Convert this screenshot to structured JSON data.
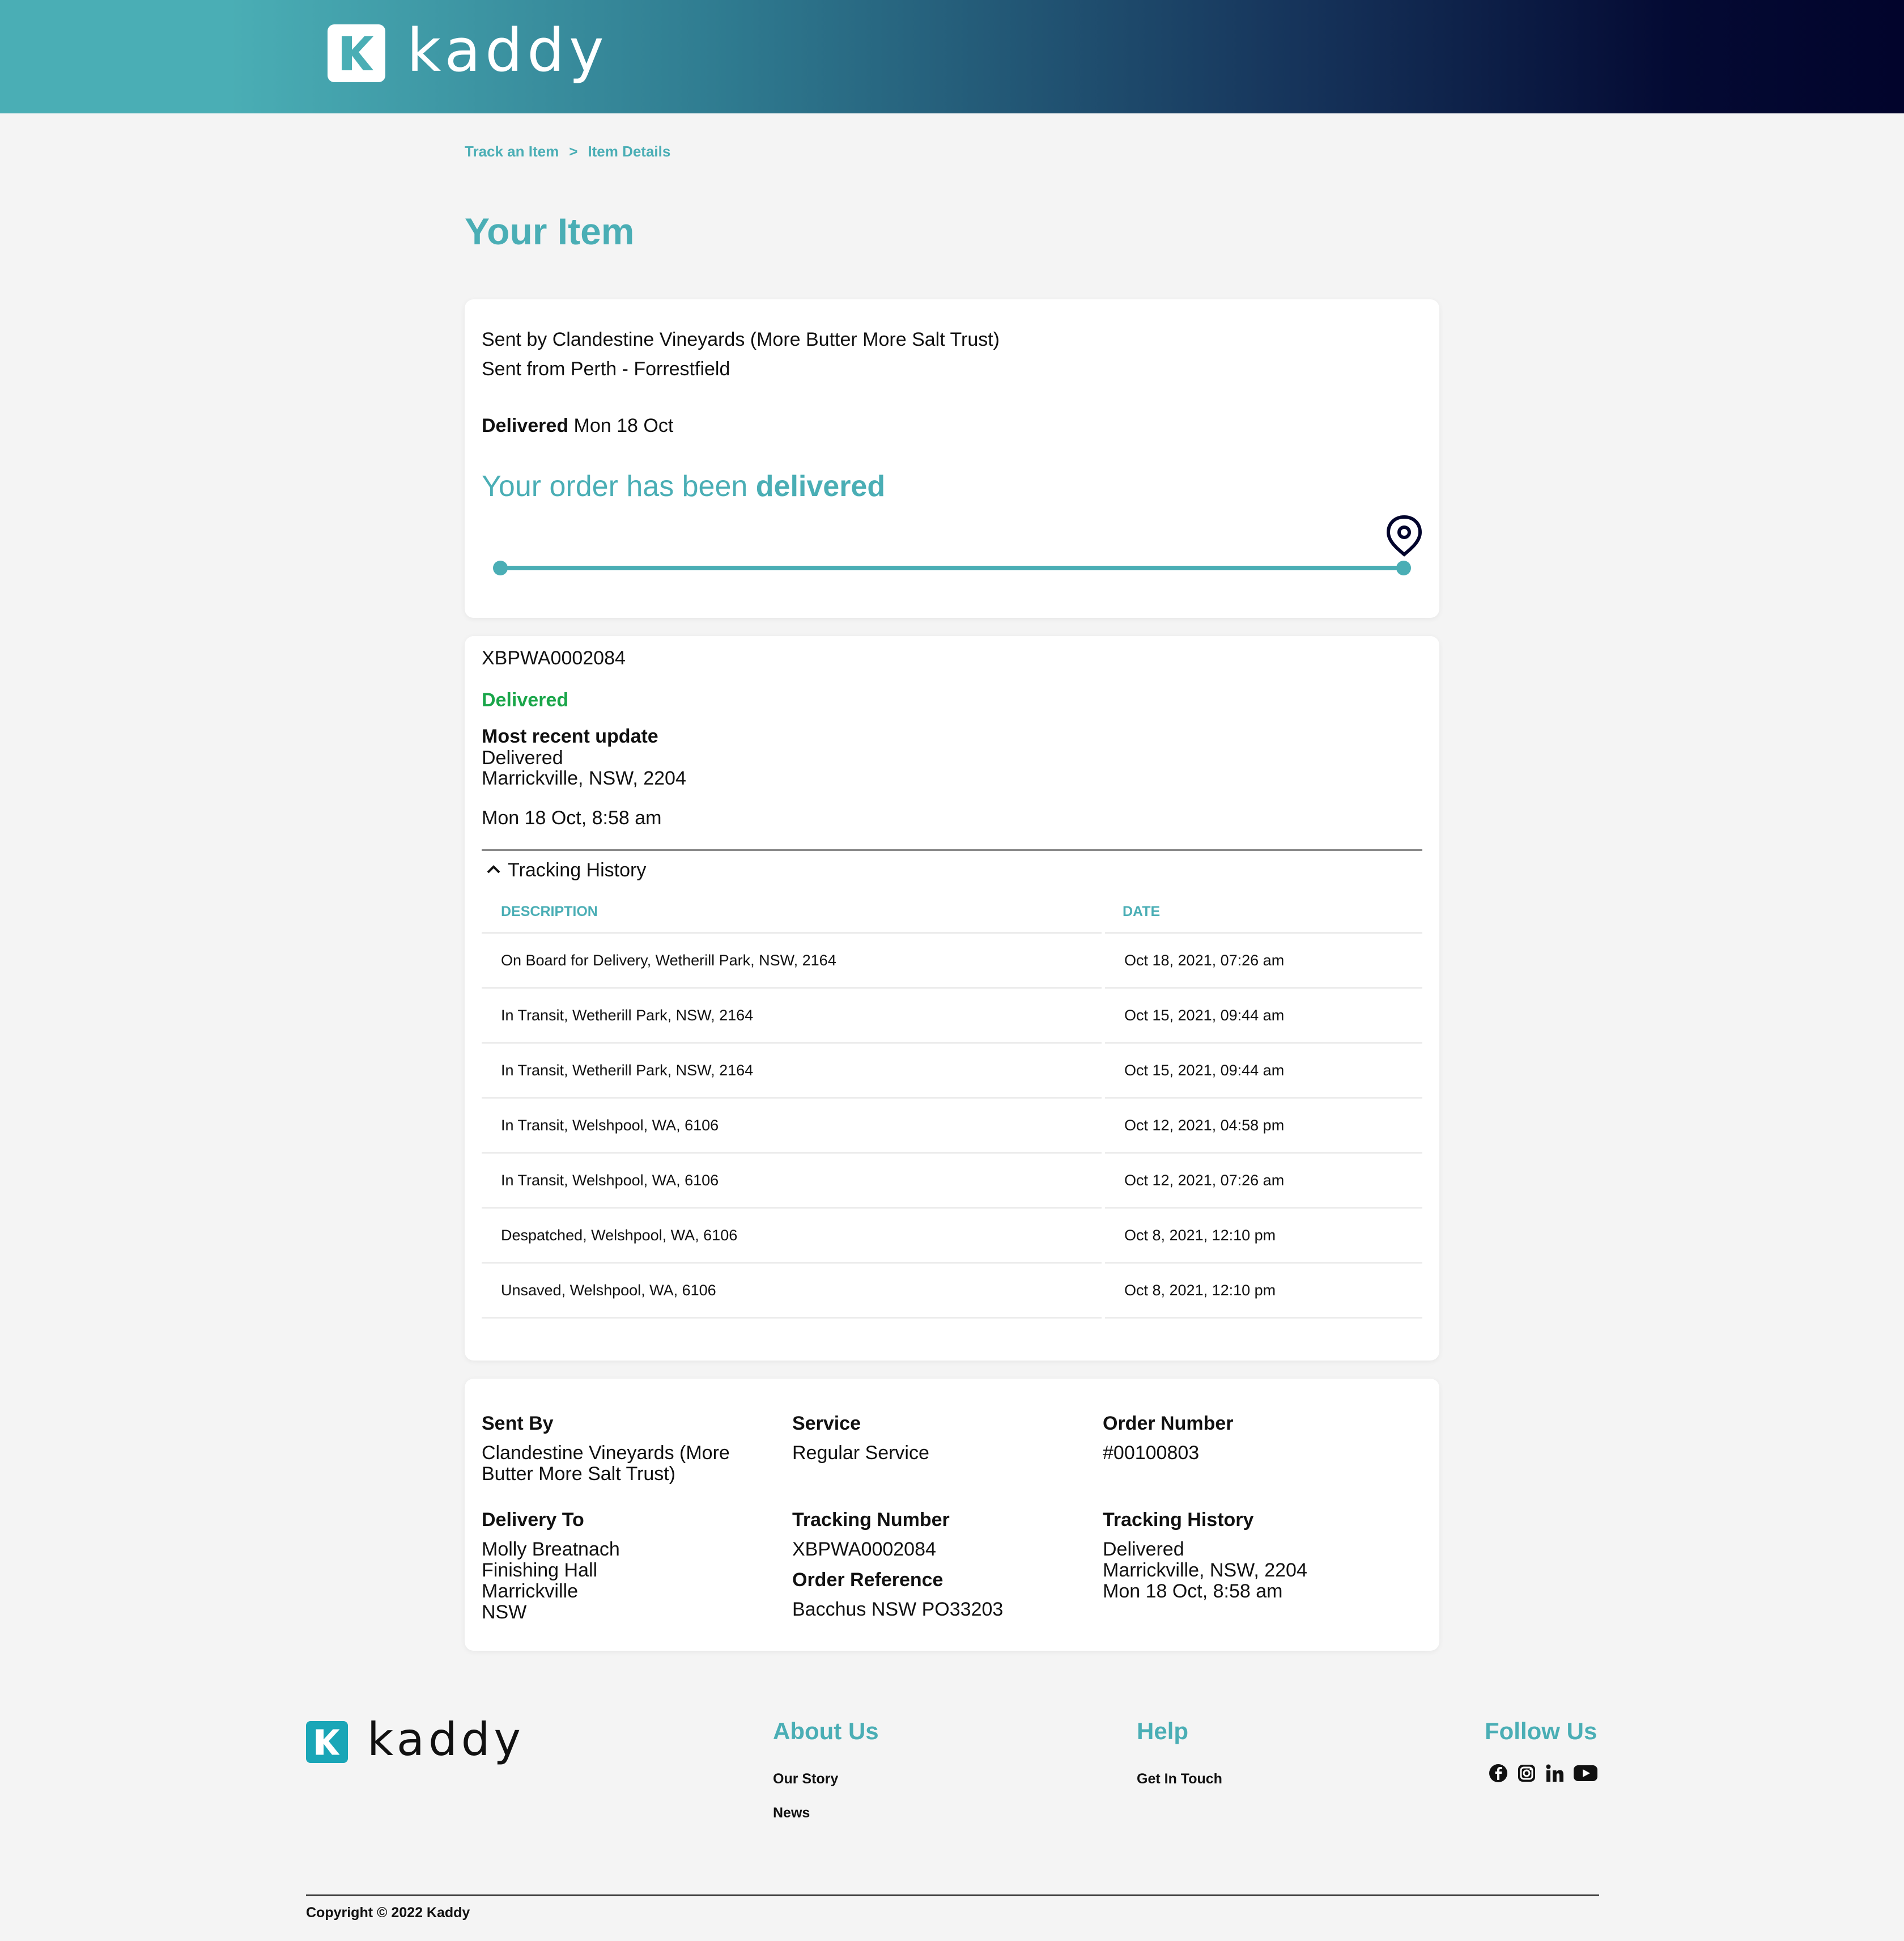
{
  "brand": {
    "name": "kaddy",
    "accent": "#4aaeb5",
    "status_green": "#1aa64a",
    "navy": "#02042c"
  },
  "breadcrumb": {
    "item1": "Track an Item",
    "separator": ">",
    "item2": "Item Details"
  },
  "page_title": "Your Item",
  "summary": {
    "sent_by": "Sent by Clandestine Vineyards (More Butter More Salt Trust)",
    "sent_from": "Sent from Perth - Forrestfield",
    "delivered_label": "Delivered",
    "delivered_date": "Mon 18 Oct",
    "status_prefix": "Your order has been",
    "status_word": "delivered",
    "progress_fraction": 1.0,
    "icon": "location-pin-icon"
  },
  "tracking": {
    "number": "XBPWA0002084",
    "status": "Delivered",
    "recent_heading": "Most recent update",
    "recent_status": "Delivered",
    "recent_location": "Marrickville, NSW, 2204",
    "recent_time": "Mon 18 Oct, 8:58 am",
    "history_toggle": "Tracking History",
    "columns": {
      "description": "DESCRIPTION",
      "date": "DATE"
    },
    "rows": [
      {
        "description": "On Board for Delivery, Wetherill Park, NSW, 2164",
        "date": "Oct 18, 2021, 07:26 am"
      },
      {
        "description": "In Transit, Wetherill Park, NSW, 2164",
        "date": "Oct 15, 2021, 09:44 am"
      },
      {
        "description": "In Transit, Wetherill Park, NSW, 2164",
        "date": "Oct 15, 2021, 09:44 am"
      },
      {
        "description": "In Transit, Welshpool, WA, 6106",
        "date": "Oct 12, 2021, 04:58 pm"
      },
      {
        "description": "In Transit, Welshpool, WA, 6106",
        "date": "Oct 12, 2021, 07:26 am"
      },
      {
        "description": "Despatched, Welshpool, WA, 6106",
        "date": "Oct 8, 2021, 12:10 pm"
      },
      {
        "description": "Unsaved, Welshpool, WA, 6106",
        "date": "Oct 8, 2021, 12:10 pm"
      }
    ]
  },
  "details": {
    "sent_by_label": "Sent By",
    "sent_by_line1": "Clandestine Vineyards (More",
    "sent_by_line2": "Butter More Salt Trust)",
    "service_label": "Service",
    "service_value": "Regular Service",
    "order_number_label": "Order Number",
    "order_number_value": "#00100803",
    "delivery_to_label": "Delivery To",
    "delivery_to_lines": [
      "Molly Breatnach",
      "Finishing Hall",
      "Marrickville",
      "NSW"
    ],
    "tracking_number_label": "Tracking Number",
    "tracking_number_value": "XBPWA0002084",
    "order_reference_label": "Order Reference",
    "order_reference_value": "Bacchus NSW PO33203",
    "tracking_history_label": "Tracking History",
    "tracking_history_lines": [
      "Delivered",
      "Marrickville, NSW, 2204",
      "Mon 18 Oct, 8:58 am"
    ]
  },
  "footer": {
    "about_heading": "About Us",
    "about_links": [
      "Our Story",
      "News"
    ],
    "help_heading": "Help",
    "help_links": [
      "Get In Touch"
    ],
    "follow_heading": "Follow Us",
    "social_icons": [
      "facebook-icon",
      "instagram-icon",
      "linkedin-icon",
      "youtube-icon"
    ],
    "copyright": "Copyright © 2022 Kaddy"
  }
}
